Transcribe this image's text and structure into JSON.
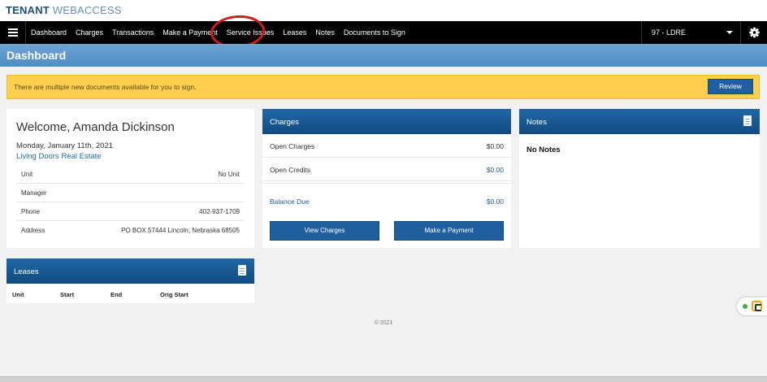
{
  "brand": {
    "part1": "TENANT",
    "part2": "WEBACCESS"
  },
  "nav": {
    "items": [
      {
        "label": "Dashboard"
      },
      {
        "label": "Charges"
      },
      {
        "label": "Transactions"
      },
      {
        "label": "Make a Payment"
      },
      {
        "label": "Service Issues"
      },
      {
        "label": "Leases"
      },
      {
        "label": "Notes"
      },
      {
        "label": "Documents to Sign"
      }
    ],
    "property_selected": "97 - LDRE",
    "menu_icon": "hamburger-menu-icon",
    "settings_icon": "gear-icon"
  },
  "page": {
    "title": "Dashboard"
  },
  "alert": {
    "text": "There are multiple new documents available for you to sign.",
    "button_label": "Review",
    "color": "#ffcf4d"
  },
  "welcome": {
    "title": "Welcome, Amanda Dickinson",
    "date": "Monday, January 11th, 2021",
    "company": "Living Doors Real Estate",
    "rows": [
      {
        "label": "Unit",
        "value": "No Unit"
      },
      {
        "label": "Manager",
        "value": ""
      },
      {
        "label": "Phone",
        "value": "402-937-1709"
      },
      {
        "label": "Address",
        "value": "PO BOX 57444 Lincoln, Nebraska 68505"
      }
    ]
  },
  "charges": {
    "title": "Charges",
    "open_charges": {
      "label": "Open Charges",
      "value": "$0.00"
    },
    "open_credits": {
      "label": "Open Credits",
      "value": "$0.00"
    },
    "balance_due": {
      "label": "Balance Due",
      "value": "$0.00"
    },
    "view_button": "View Charges",
    "pay_button": "Make a Payment"
  },
  "notes": {
    "title": "Notes",
    "empty_text": "No Notes"
  },
  "leases": {
    "title": "Leases",
    "columns": [
      "Unit",
      "Start",
      "End",
      "Orig Start"
    ]
  },
  "footer": {
    "copyright": "© 2021"
  },
  "colors": {
    "nav_bg": "#000000",
    "header_blue": "#1f68a8",
    "button_blue": "#1f5fa0",
    "annotation_red": "#d31c1c"
  }
}
